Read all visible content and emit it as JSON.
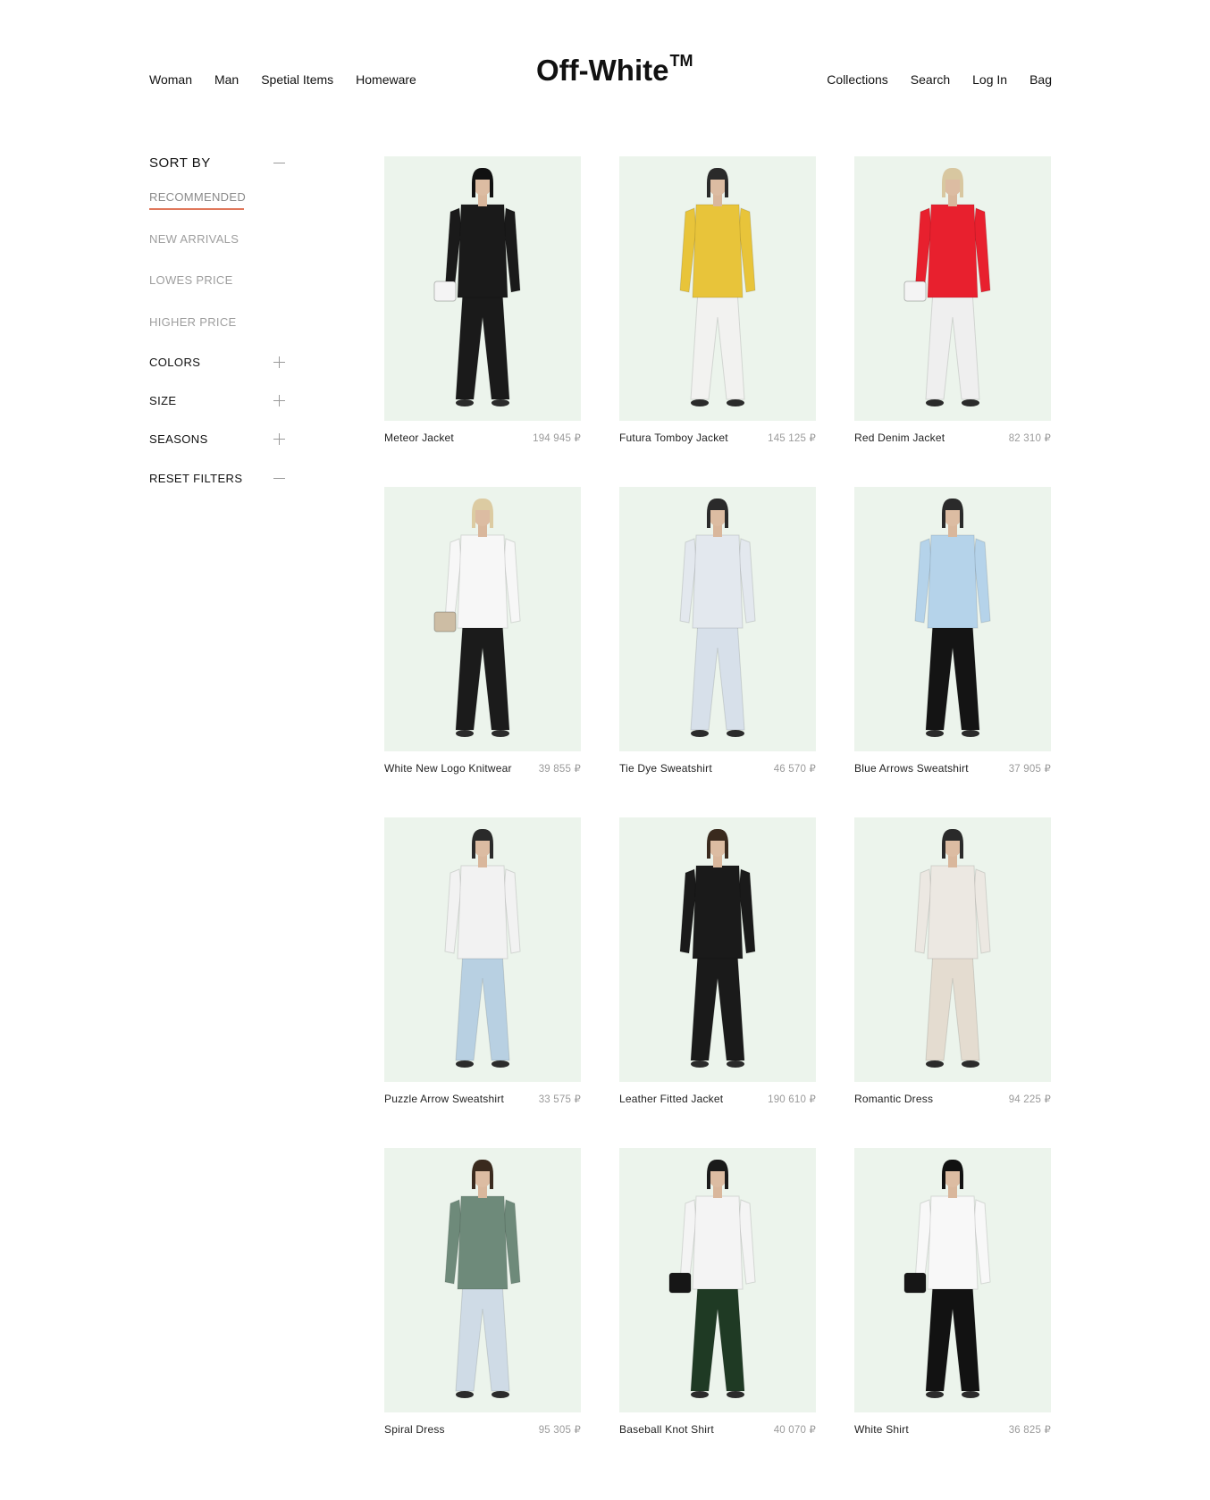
{
  "header": {
    "brand": "Off-White",
    "brand_mark": "TM",
    "nav_left": [
      "Woman",
      "Man",
      "Spetial Items",
      "Homeware"
    ],
    "nav_right": [
      "Collections",
      "Search",
      "Log In",
      "Bag"
    ]
  },
  "sidebar": {
    "sort_by_label": "SORT BY",
    "sort_options": [
      "RECOMMENDED",
      "NEW ARRIVALS",
      "LOWES PRICE",
      "HIGHER PRICE"
    ],
    "active_sort": "RECOMMENDED",
    "filters": [
      {
        "label": "COLORS",
        "icon": "plus-icon"
      },
      {
        "label": "SIZE",
        "icon": "plus-icon"
      },
      {
        "label": "SEASONS",
        "icon": "plus-icon"
      },
      {
        "label": "RESET FILTERS",
        "icon": "minus-icon"
      }
    ],
    "accent_color": "#e0785c"
  },
  "products": [
    {
      "name": "Meteor Jacket",
      "price": "194 945 ₽",
      "top": "#1a1a1a",
      "bottom": "#1a1a1a",
      "hair": "#111111",
      "accessory": "bag-white"
    },
    {
      "name": "Futura Tomboy Jacket",
      "price": "145 125 ₽",
      "top": "#e8c43a",
      "bottom": "#f2f2f0",
      "hair": "#2a2a2a",
      "accessory": "none"
    },
    {
      "name": "Red Denim Jacket",
      "price": "82 310 ₽",
      "top": "#e8202e",
      "bottom": "#efefef",
      "hair": "#d8c7a0",
      "accessory": "bag-white"
    },
    {
      "name": "White New Logo Knitwear",
      "price": "39 855 ₽",
      "top": "#f7f7f7",
      "bottom": "#1b1b1b",
      "hair": "#dccba2",
      "accessory": "bag-beige"
    },
    {
      "name": "Tie Dye Sweatshirt",
      "price": "46 570 ₽",
      "top": "#e3e8ee",
      "bottom": "#d7e0ea",
      "hair": "#2a2a2a",
      "accessory": "none"
    },
    {
      "name": "Blue Arrows Sweatshirt",
      "price": "37 905 ₽",
      "top": "#b5d3ea",
      "bottom": "#141414",
      "hair": "#2a2a2a",
      "accessory": "none"
    },
    {
      "name": "Puzzle Arrow Sweatshirt",
      "price": "33 575 ₽",
      "top": "#f2f2f2",
      "bottom": "#b8d0e2",
      "hair": "#2a2a2a",
      "accessory": "none"
    },
    {
      "name": "Leather Fitted Jacket",
      "price": "190 610 ₽",
      "top": "#1a1a1a",
      "bottom": "#1a1a1a",
      "hair": "#3a2a1e",
      "accessory": "none"
    },
    {
      "name": "Romantic Dress",
      "price": "94 225 ₽",
      "top": "#ece8e2",
      "bottom": "#e4dcd0",
      "hair": "#2a2a2a",
      "accessory": "none"
    },
    {
      "name": "Spiral Dress",
      "price": "95 305 ₽",
      "top": "#6e8a7a",
      "bottom": "#cfdbe6",
      "hair": "#3a2a1e",
      "accessory": "none"
    },
    {
      "name": "Baseball Knot Shirt",
      "price": "40 070 ₽",
      "top": "#f4f4f4",
      "bottom": "#1f3a24",
      "hair": "#1a1a1a",
      "accessory": "bag-black"
    },
    {
      "name": "White Shirt",
      "price": "36 825 ₽",
      "top": "#f8f8f8",
      "bottom": "#121212",
      "hair": "#111111",
      "accessory": "bag-black"
    }
  ]
}
